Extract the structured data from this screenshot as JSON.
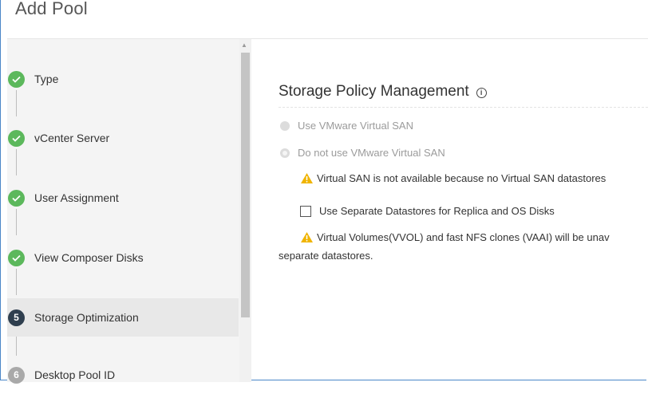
{
  "window": {
    "title": "Add Pool"
  },
  "wizard": {
    "steps": [
      {
        "label": "Type",
        "status": "done",
        "icon": "check-icon"
      },
      {
        "label": "vCenter Server",
        "status": "done",
        "icon": "check-icon"
      },
      {
        "label": "User Assignment",
        "status": "done",
        "icon": "check-icon"
      },
      {
        "label": "View Composer Disks",
        "status": "done",
        "icon": "check-icon"
      },
      {
        "label": "Storage Optimization",
        "status": "current",
        "number": "5"
      },
      {
        "label": "Desktop Pool ID",
        "status": "pending",
        "number": "6"
      }
    ]
  },
  "main": {
    "section_title": "Storage Policy Management",
    "info_icon": "i",
    "options": {
      "use_vsan": "Use VMware Virtual SAN",
      "no_vsan": "Do not use VMware Virtual SAN"
    },
    "vsan_warning": "Virtual SAN is not available because no Virtual SAN datastores",
    "separate_datastores_label": "Use Separate Datastores for Replica and OS Disks",
    "vvol_warning_line1": "Virtual Volumes(VVOL) and fast NFS clones (VAAI) will be unav",
    "vvol_warning_line2": "separate datastores."
  },
  "colors": {
    "done": "#5cb85c",
    "current": "#2f3f4f",
    "pending": "#a9a9a9",
    "warning": "#f0b400",
    "frame": "#4a86c8"
  }
}
